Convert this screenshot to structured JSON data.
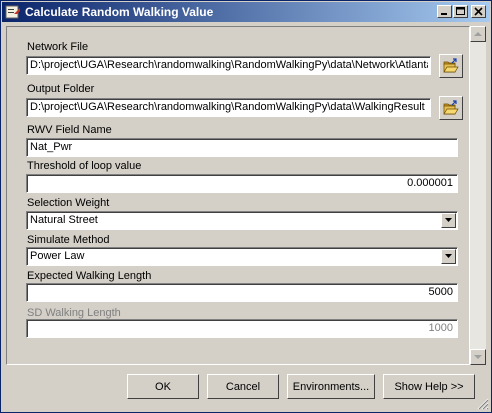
{
  "window": {
    "title": "Calculate Random Walking Value"
  },
  "fields": {
    "network_file": {
      "label": "Network File",
      "value": "D:\\project\\UGA\\Research\\randomwalking\\RandomWalkingPy\\data\\Network\\Atlanta"
    },
    "output_folder": {
      "label": "Output Folder",
      "value": "D:\\project\\UGA\\Research\\randomwalking\\RandomWalkingPy\\data\\WalkingResult"
    },
    "rwv_field_name": {
      "label": "RWV Field Name",
      "value": "Nat_Pwr"
    },
    "threshold": {
      "label": "Threshold of loop value",
      "value": "0.000001"
    },
    "selection_weight": {
      "label": "Selection Weight",
      "value": "Natural Street"
    },
    "simulate_method": {
      "label": "Simulate Method",
      "value": "Power Law"
    },
    "expected_length": {
      "label": "Expected Walking Length",
      "value": "5000"
    },
    "sd_length": {
      "label": "SD Walking Length",
      "value": "1000"
    }
  },
  "buttons": {
    "ok": "OK",
    "cancel": "Cancel",
    "environments": "Environments...",
    "show_help": "Show Help >>"
  },
  "icons": {
    "title": "tool-icon",
    "minimize": "minimize-icon",
    "maximize": "maximize-icon",
    "close": "close-icon",
    "browse": "open-folder-icon",
    "dropdown": "chevron-down-icon"
  }
}
